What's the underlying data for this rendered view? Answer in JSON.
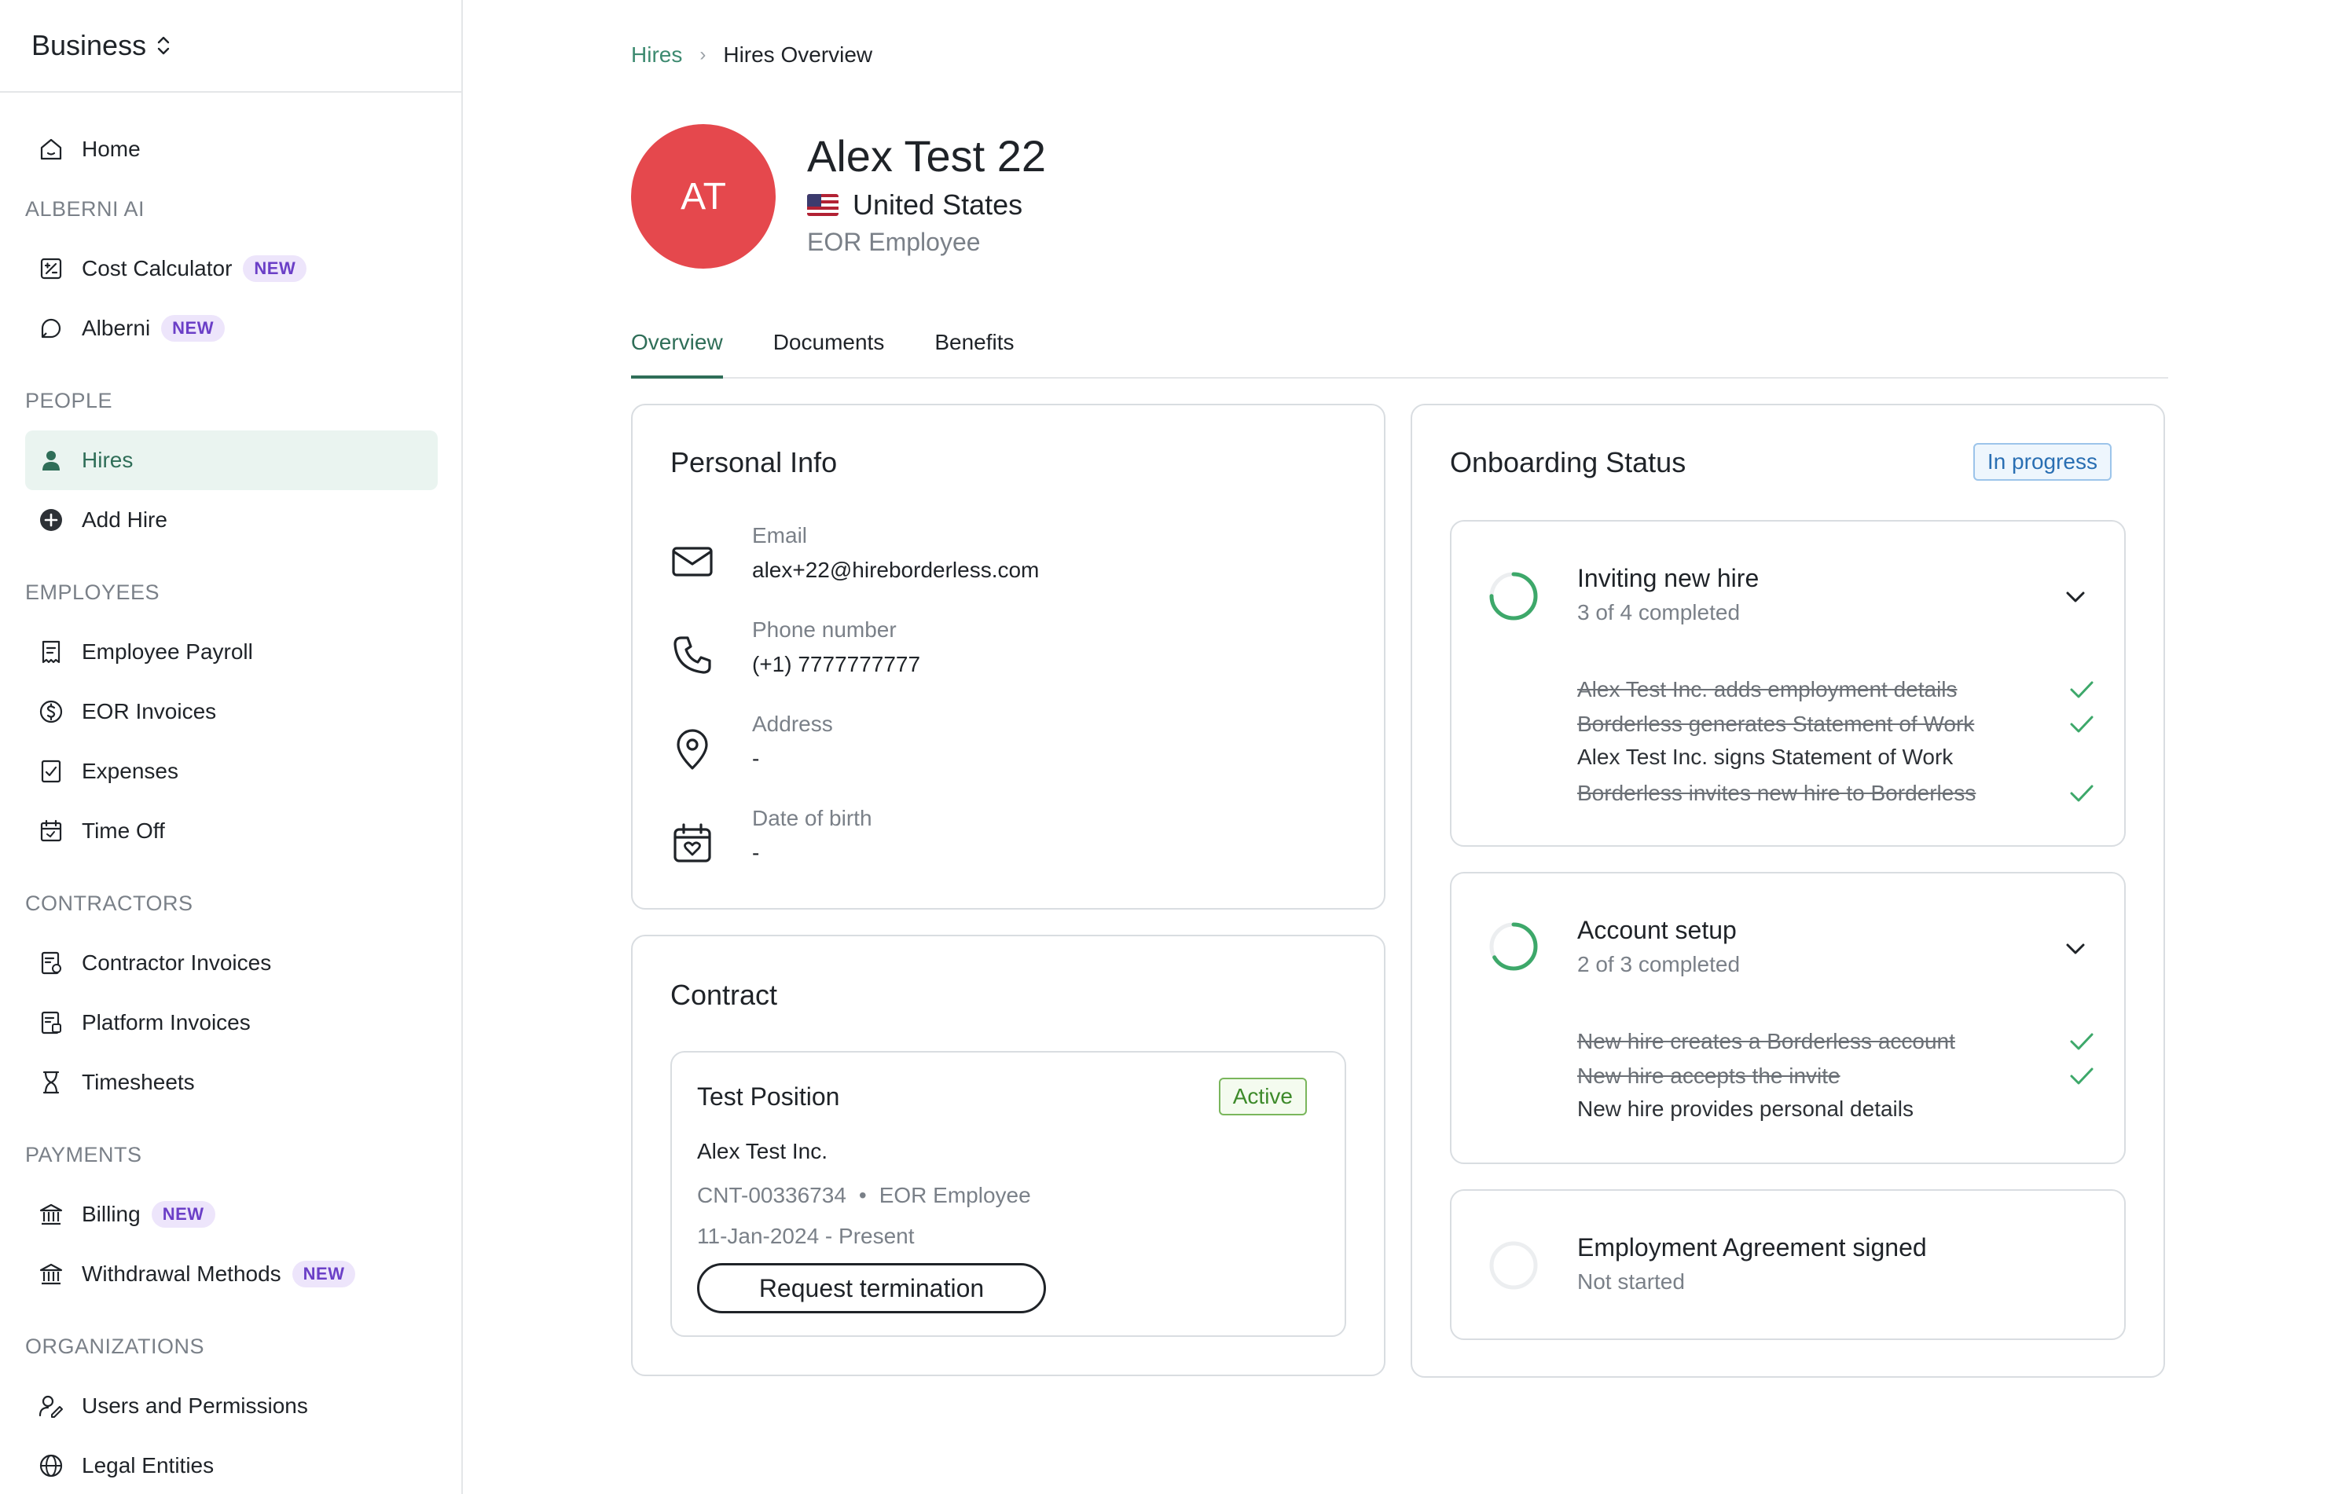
{
  "sidebar": {
    "brand": "Business",
    "items": {
      "home": "Home",
      "cost_calculator": "Cost Calculator",
      "alberni": "Alberni",
      "hires": "Hires",
      "add_hire": "Add Hire",
      "employee_payroll": "Employee Payroll",
      "eor_invoices": "EOR Invoices",
      "expenses": "Expenses",
      "time_off": "Time Off",
      "contractor_invoices": "Contractor Invoices",
      "platform_invoices": "Platform Invoices",
      "timesheets": "Timesheets",
      "billing": "Billing",
      "withdrawal_methods": "Withdrawal Methods",
      "users_permissions": "Users and Permissions",
      "legal_entities": "Legal Entities"
    },
    "sections": {
      "alberni_ai": "ALBERNI AI",
      "people": "PEOPLE",
      "employees": "EMPLOYEES",
      "contractors": "CONTRACTORS",
      "payments": "PAYMENTS",
      "organizations": "ORGANIZATIONS"
    },
    "new_badge": "NEW"
  },
  "breadcrumb": {
    "parent": "Hires",
    "separator": "›",
    "current": "Hires Overview"
  },
  "profile": {
    "initials": "AT",
    "name": "Alex Test 22",
    "country": "United States",
    "role": "EOR Employee",
    "avatar_color": "#e5484d"
  },
  "tabs": [
    "Overview",
    "Documents",
    "Benefits"
  ],
  "personal_info": {
    "title": "Personal Info",
    "email_label": "Email",
    "email": "alex+22@hireborderless.com",
    "phone_label": "Phone number",
    "phone": "(+1) 7777777777",
    "address_label": "Address",
    "address": "-",
    "dob_label": "Date of birth",
    "dob": "-"
  },
  "contract": {
    "title": "Contract",
    "position": "Test Position",
    "status": "Active",
    "company": "Alex Test Inc.",
    "contract_id": "CNT-00336734",
    "bullet": "•",
    "type": "EOR Employee",
    "period": "11-Jan-2024 - Present",
    "terminate_label": "Request termination"
  },
  "onboarding": {
    "title": "Onboarding Status",
    "status": "In progress",
    "steps": [
      {
        "title": "Inviting new hire",
        "progress": "3 of 4 completed",
        "completed": 3,
        "total": 4,
        "tasks": [
          {
            "label": "Alex Test Inc. adds employment details",
            "done": true
          },
          {
            "label": "Borderless generates Statement of Work",
            "done": true
          },
          {
            "label": "Alex Test Inc. signs Statement of Work",
            "done": false
          },
          {
            "label": "Borderless invites new hire to Borderless",
            "done": true
          }
        ]
      },
      {
        "title": "Account setup",
        "progress": "2 of 3 completed",
        "completed": 2,
        "total": 3,
        "tasks": [
          {
            "label": "New hire creates a Borderless account",
            "done": true
          },
          {
            "label": "New hire accepts the invite",
            "done": true
          },
          {
            "label": "New hire provides personal details",
            "done": false
          }
        ]
      },
      {
        "title": "Employment Agreement signed",
        "progress": "Not started",
        "completed": 0,
        "total": 1
      }
    ]
  },
  "colors": {
    "accent": "#2f6e58",
    "check": "#3da86a",
    "ring": "#3da86a"
  }
}
